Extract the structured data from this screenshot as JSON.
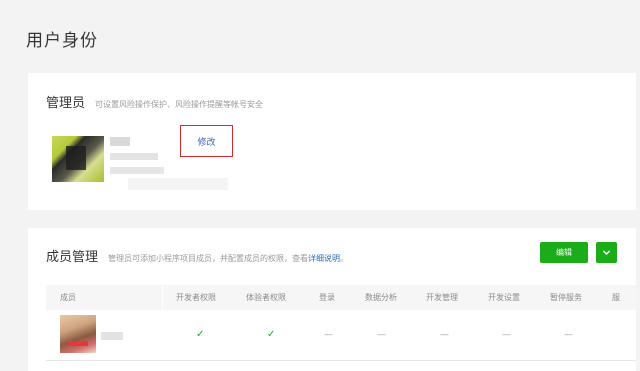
{
  "page": {
    "title": "用户身份"
  },
  "admin": {
    "title": "管理员",
    "description": "可设置风险操作保护、风险操作提醒等帐号安全",
    "edit_label": "修改"
  },
  "members": {
    "title": "成员管理",
    "description": "管理员可添加小程序项目成员，并配置成员的权限，查看",
    "description_link": "详细说明",
    "description_end": "。",
    "edit_button": "编辑",
    "dropdown_icon": "chevron-down-icon",
    "columns": [
      "成员",
      "开发者权限",
      "体验者权限",
      "登录",
      "数据分析",
      "开发管理",
      "开发设置",
      "暂停服务",
      "服"
    ],
    "rows": [
      {
        "cells": [
          "✓",
          "✓",
          "—",
          "—",
          "—",
          "—",
          "—"
        ]
      }
    ]
  },
  "colors": {
    "accent": "#1aad19",
    "link": "#2c6bb6",
    "highlight_border": "#d22a2a"
  }
}
